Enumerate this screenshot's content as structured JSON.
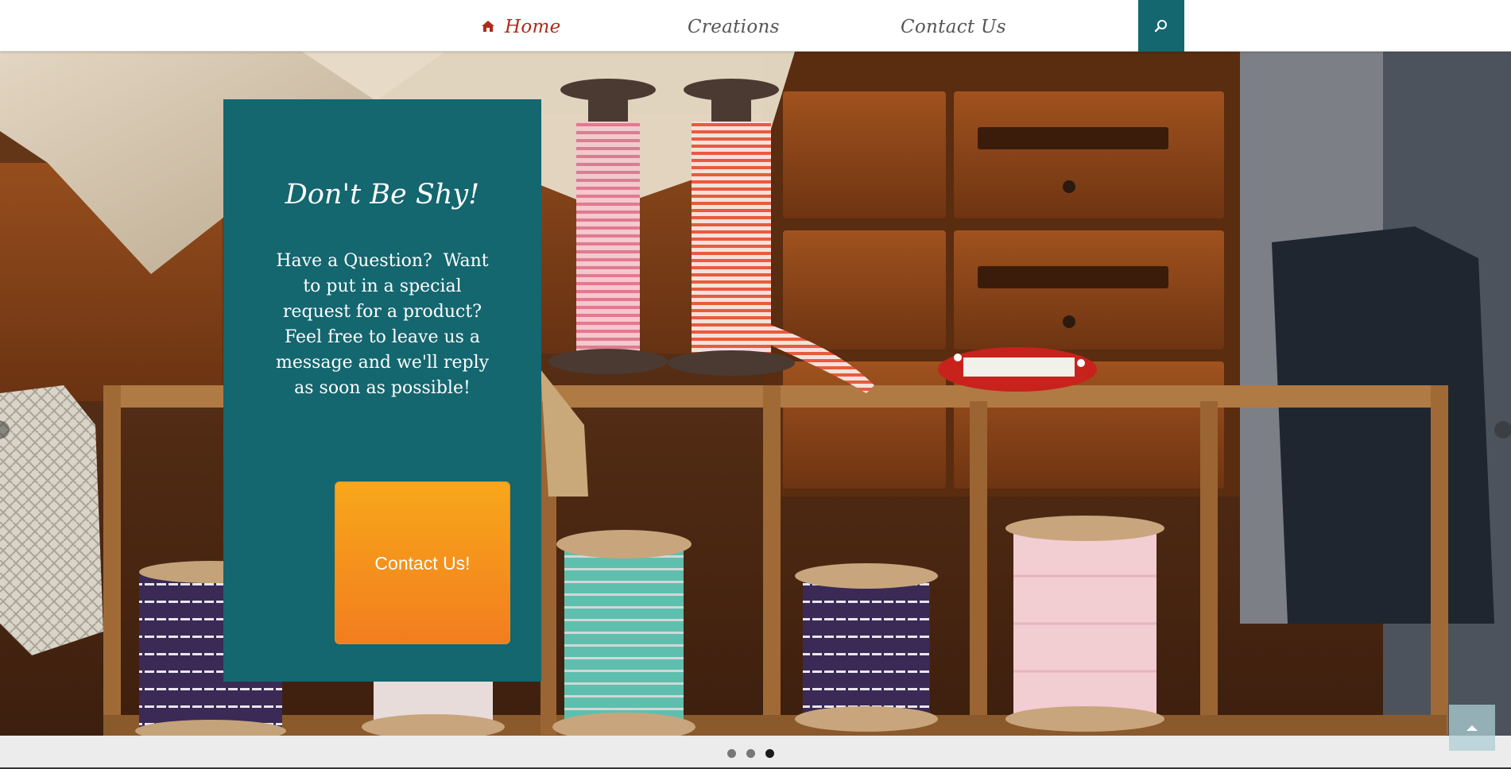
{
  "nav": {
    "items": [
      {
        "label": "Home",
        "icon": "home-icon",
        "active": true
      },
      {
        "label": "Creations",
        "active": false
      },
      {
        "label": "Contact Us",
        "active": false
      }
    ],
    "search_icon": "search-icon"
  },
  "hero": {
    "card": {
      "title": "Don't Be Shy!",
      "text": "Have a Question?  Want to put in a special request for a product?  Feel free to leave us a message and we'll reply as soon as possible!",
      "cta_label": "Contact Us!"
    },
    "slider": {
      "slide_count": 3,
      "active_slide": 3
    }
  },
  "colors": {
    "accent_teal": "#14666f",
    "active_nav": "#b02a1c",
    "cta_top": "#f8a71b",
    "cta_bottom": "#f27d1e"
  }
}
